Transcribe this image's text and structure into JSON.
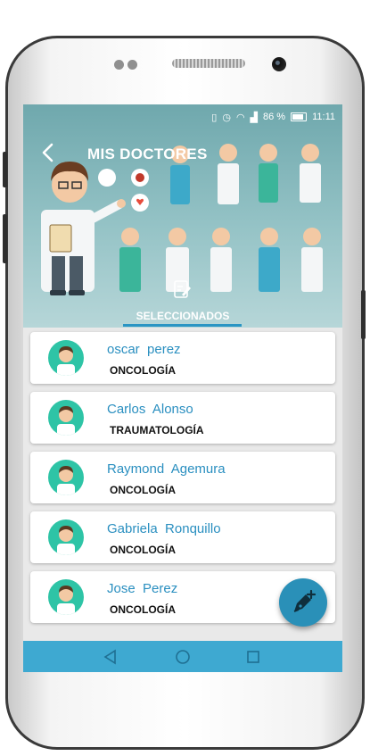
{
  "status_bar": {
    "battery": "86 %",
    "time": "11:11"
  },
  "header": {
    "title": "MIS DOCTORES",
    "tab_label": "SELECCIONADOS"
  },
  "doctors": [
    {
      "first": "oscar",
      "last": "perez",
      "specialty": "ONCOLOGÍA"
    },
    {
      "first": "Carlos",
      "last": "Alonso",
      "specialty": "TRAUMATOLOGÍA"
    },
    {
      "first": "Raymond",
      "last": "Agemura",
      "specialty": "ONCOLOGÍA"
    },
    {
      "first": "Gabriela",
      "last": "Ronquillo",
      "specialty": "ONCOLOGÍA"
    },
    {
      "first": "Jose",
      "last": "Perez",
      "specialty": "ONCOLOGÍA"
    }
  ],
  "colors": {
    "header": "#8fbfc2",
    "accent": "#2a8fc0",
    "navbar": "#3ea9d1",
    "avatar_bg": "#2ec4a6"
  },
  "icons": {
    "back": "arrow-left-icon",
    "tab": "edit-document-icon",
    "fab": "pen-add-icon"
  }
}
